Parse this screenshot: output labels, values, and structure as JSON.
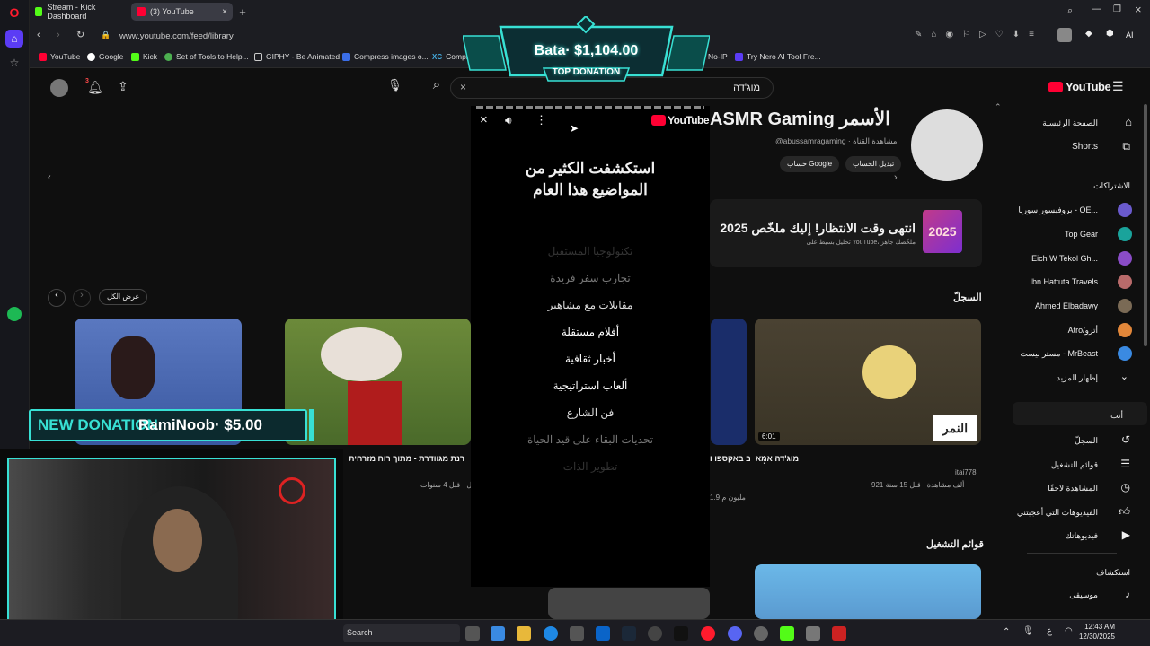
{
  "browser": {
    "tabs": [
      {
        "label": "Stream - Kick Dashboard"
      },
      {
        "label": "(3) YouTube"
      }
    ],
    "url": "www.youtube.com/feed/library",
    "bookmarks": [
      "YouTube",
      "Google",
      "Kick",
      "Set of Tools to Help...",
      "GIPHY - Be Animated",
      "Compress images o...",
      "Compres",
      "No-IP",
      "Try Nero AI Tool Fre..."
    ],
    "extension_badge": "AI"
  },
  "donation_banner": {
    "text": "Bata· $1,104.00",
    "label": "TOP DONATION"
  },
  "new_donation": {
    "label": "NEW DONATION",
    "text": "RamiNoob· $5.00"
  },
  "youtube": {
    "logo": "YouTube",
    "notif_count": "3",
    "search_value": "מוג'דה",
    "channel": {
      "name": "ASMR Gaming الأسمر",
      "handle": "@abussamragaming · مشاهدة القناة",
      "switch_account": "تبديل الحساب",
      "google_account": "حساب Google"
    },
    "recap": {
      "title": "انتهى وقت الانتظار! إليك ملخّص 2025",
      "sub": "تحليل بسيط على YouTube، ملخّصك جاهز",
      "badge": "2025"
    },
    "history_title": "السجلّ",
    "view_all": "عرض الكل",
    "playlists_title": "قوائم التشغيل",
    "videos": [
      {
        "title": "מוג'דה אמא",
        "channel": "itai778",
        "meta": "921 ألف مشاهدة · قبل 15 سنة",
        "duration": "6:01",
        "logo": "النمر"
      },
      {
        "title": "רינת בר ב באקספו ו",
        "channel": "",
        "meta": "1.9 مليون م",
        "duration": "",
        "logo": ""
      },
      {
        "title": "רנת מגוודרת - מתוך רוח מזרחית",
        "channel": "",
        "meta": "ـل · قبل 4 سنوات",
        "duration": "",
        "logo": ""
      }
    ],
    "sidebar": {
      "home": "الصفحة الرئيسية",
      "shorts": "Shorts",
      "subscriptions": "الاشتراكات",
      "channels": [
        "بروفيسور سوريا - OE...",
        "Top Gear",
        "Eich W Tekol Gh...",
        "Ibn Hattuta Travels",
        "Ahmed Elbadawy",
        "Atro/أترو",
        "مستر بيست - MrBeast"
      ],
      "show_more": "إظهار المزيد",
      "you": "أنت",
      "you_items": [
        "السجلّ",
        "قوائم التشغيل",
        "المشاهدة لاحقًا",
        "الفيديوهات التي أعجبتني",
        "فيديوهاتك"
      ],
      "explore": "استكشاف",
      "music": "موسيقى"
    },
    "recap_panel": {
      "logo": "YouTube",
      "heading": "استكشفت الكثير من المواضيع هذا العام",
      "topics": [
        "تكنولوجيا المستقبل",
        "تجارب سفر فريدة",
        "مقابلات مع مشاهير",
        "أفلام مستقلة",
        "أخبار ثقافية",
        "ألعاب استراتيجية",
        "فن الشارع",
        "تحديات البقاء على قيد الحياة",
        "تطوير الذات"
      ]
    }
  },
  "taskbar": {
    "search": "Search",
    "time": "12:43 AM",
    "date": "12/30/2025",
    "lang": "ع"
  },
  "colors": {
    "youtube_red": "#ff0033",
    "teal": "#38e0d4",
    "kick_green": "#53fc18"
  }
}
